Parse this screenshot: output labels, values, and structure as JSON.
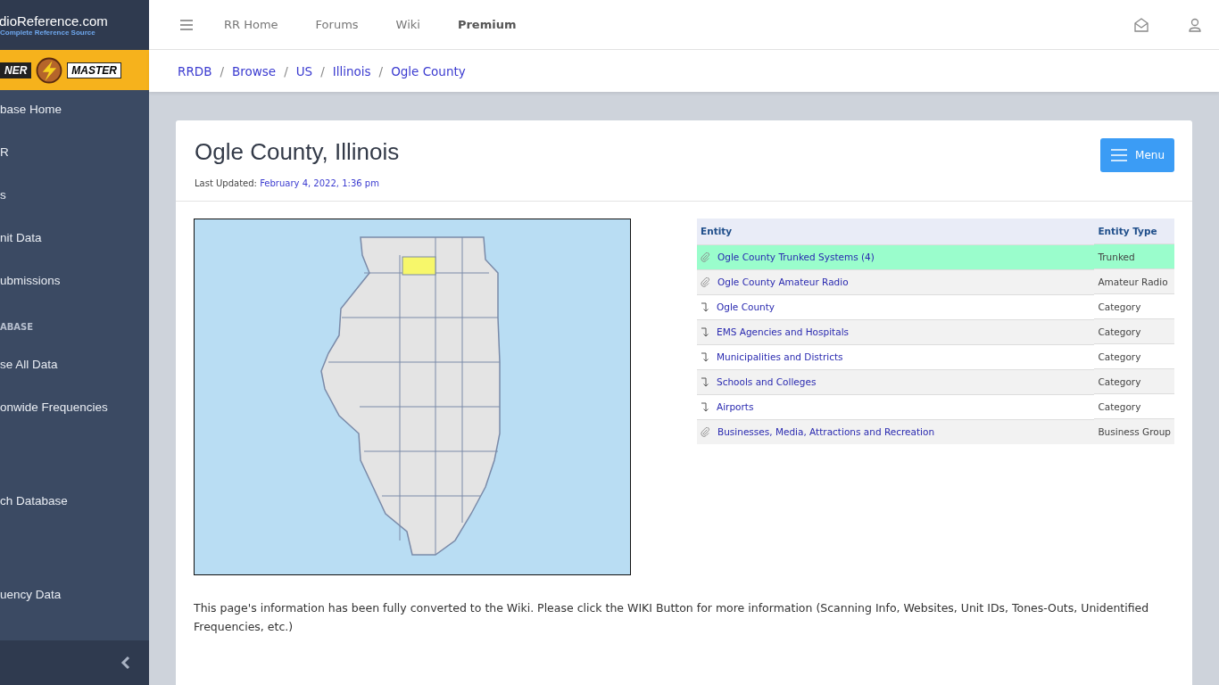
{
  "sidebar": {
    "logo": {
      "name": "dioReference.com",
      "tagline": "Complete Reference Source"
    },
    "banner": {
      "left": "NER",
      "right": "MASTER"
    },
    "items": [
      {
        "kind": "link",
        "label": "base Home"
      },
      {
        "kind": "link",
        "label": "R"
      },
      {
        "kind": "link",
        "label": "s"
      },
      {
        "kind": "link",
        "label": "nit Data"
      },
      {
        "kind": "link",
        "label": "ubmissions"
      },
      {
        "kind": "header",
        "label": "ABASE"
      },
      {
        "kind": "link",
        "label": "se All Data"
      },
      {
        "kind": "link",
        "label": "onwide Frequencies"
      },
      {
        "kind": "spacer"
      },
      {
        "kind": "link",
        "label": "ch Database"
      },
      {
        "kind": "spacer"
      },
      {
        "kind": "link",
        "label": "uency Data"
      }
    ]
  },
  "topnav": {
    "items": [
      {
        "label": "RR Home",
        "bold": false
      },
      {
        "label": "Forums",
        "bold": false
      },
      {
        "label": "Wiki",
        "bold": false
      },
      {
        "label": "Premium",
        "bold": true
      }
    ]
  },
  "breadcrumb": {
    "separator": "/",
    "items": [
      "RRDB",
      "Browse",
      "US",
      "Illinois",
      "Ogle County"
    ]
  },
  "page": {
    "title": "Ogle County, Illinois",
    "updated_label": "Last Updated:",
    "updated_value": "February 4, 2022, 1:36 pm",
    "menu_button": "Menu"
  },
  "table": {
    "columns": [
      "Entity",
      "Entity Type"
    ],
    "rows": [
      {
        "kind": "link",
        "entity": "Ogle County Trunked Systems (4)",
        "type": "Trunked",
        "selected": true
      },
      {
        "kind": "link",
        "entity": "Ogle County Amateur Radio",
        "type": "Amateur Radio",
        "selected": false
      },
      {
        "kind": "category",
        "entity": "Ogle County",
        "type": "Category",
        "selected": false
      },
      {
        "kind": "category",
        "entity": "EMS Agencies and Hospitals",
        "type": "Category",
        "selected": false
      },
      {
        "kind": "category",
        "entity": "Municipalities and Districts",
        "type": "Category",
        "selected": false
      },
      {
        "kind": "category",
        "entity": "Schools and Colleges",
        "type": "Category",
        "selected": false
      },
      {
        "kind": "category",
        "entity": "Airports",
        "type": "Category",
        "selected": false
      },
      {
        "kind": "link",
        "entity": "Businesses, Media, Attractions and Recreation",
        "type": "Business Group",
        "selected": false
      }
    ]
  },
  "notice": "This page's information has been fully converted to the Wiki.  Please click the WIKI Button for more information (Scanning Info, Websites, Unit IDs, Tones-Outs, Unidentified Frequencies, etc.)"
}
